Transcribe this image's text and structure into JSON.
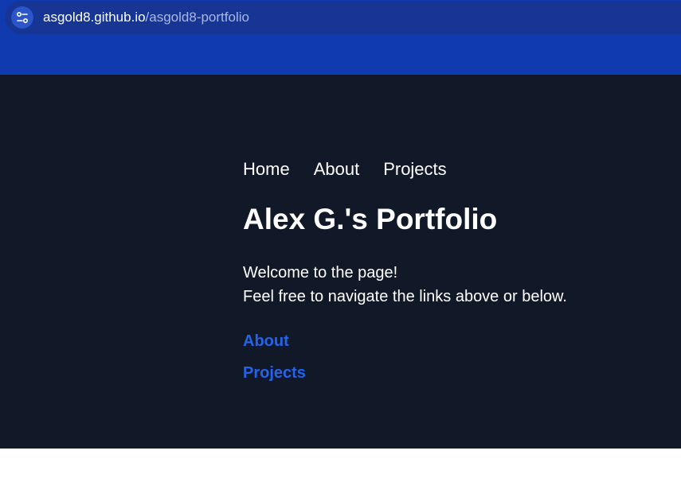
{
  "browser": {
    "url_host": "asgold8.github.io",
    "url_path": "/asgold8-portfolio",
    "site_info_icon": "tune-icon"
  },
  "nav": {
    "items": [
      {
        "label": "Home"
      },
      {
        "label": "About"
      },
      {
        "label": "Projects"
      }
    ]
  },
  "main": {
    "title": "Alex G.'s Portfolio",
    "welcome_line1": "Welcome to the page!",
    "welcome_line2": "Feel free to navigate the links above or below.",
    "links": [
      {
        "label": "About"
      },
      {
        "label": "Projects"
      }
    ]
  },
  "colors": {
    "browser_bar": "#103ab0",
    "page_bg": "#111827",
    "link": "#2563eb",
    "text": "#ffffff"
  }
}
